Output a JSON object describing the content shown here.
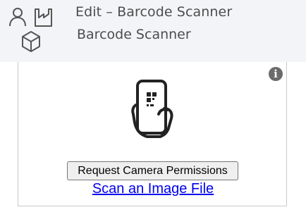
{
  "header": {
    "title": "Edit – Barcode Scanner",
    "subtitle": "Barcode Scanner",
    "icons": [
      "person-icon",
      "factory-icon",
      "box-icon"
    ]
  },
  "scanner": {
    "illustration": "phone-qr-hand-icon",
    "info_icon_label": "i",
    "camera_button_label": "Request Camera Permissions",
    "scan_file_link": "Scan an Image File"
  },
  "colors": {
    "header_bg": "#f3f4f7",
    "header_text": "#4d4d4d",
    "link": "#0000ee",
    "button_bg": "#efefef",
    "info_icon_bg": "#6b6b6b"
  }
}
